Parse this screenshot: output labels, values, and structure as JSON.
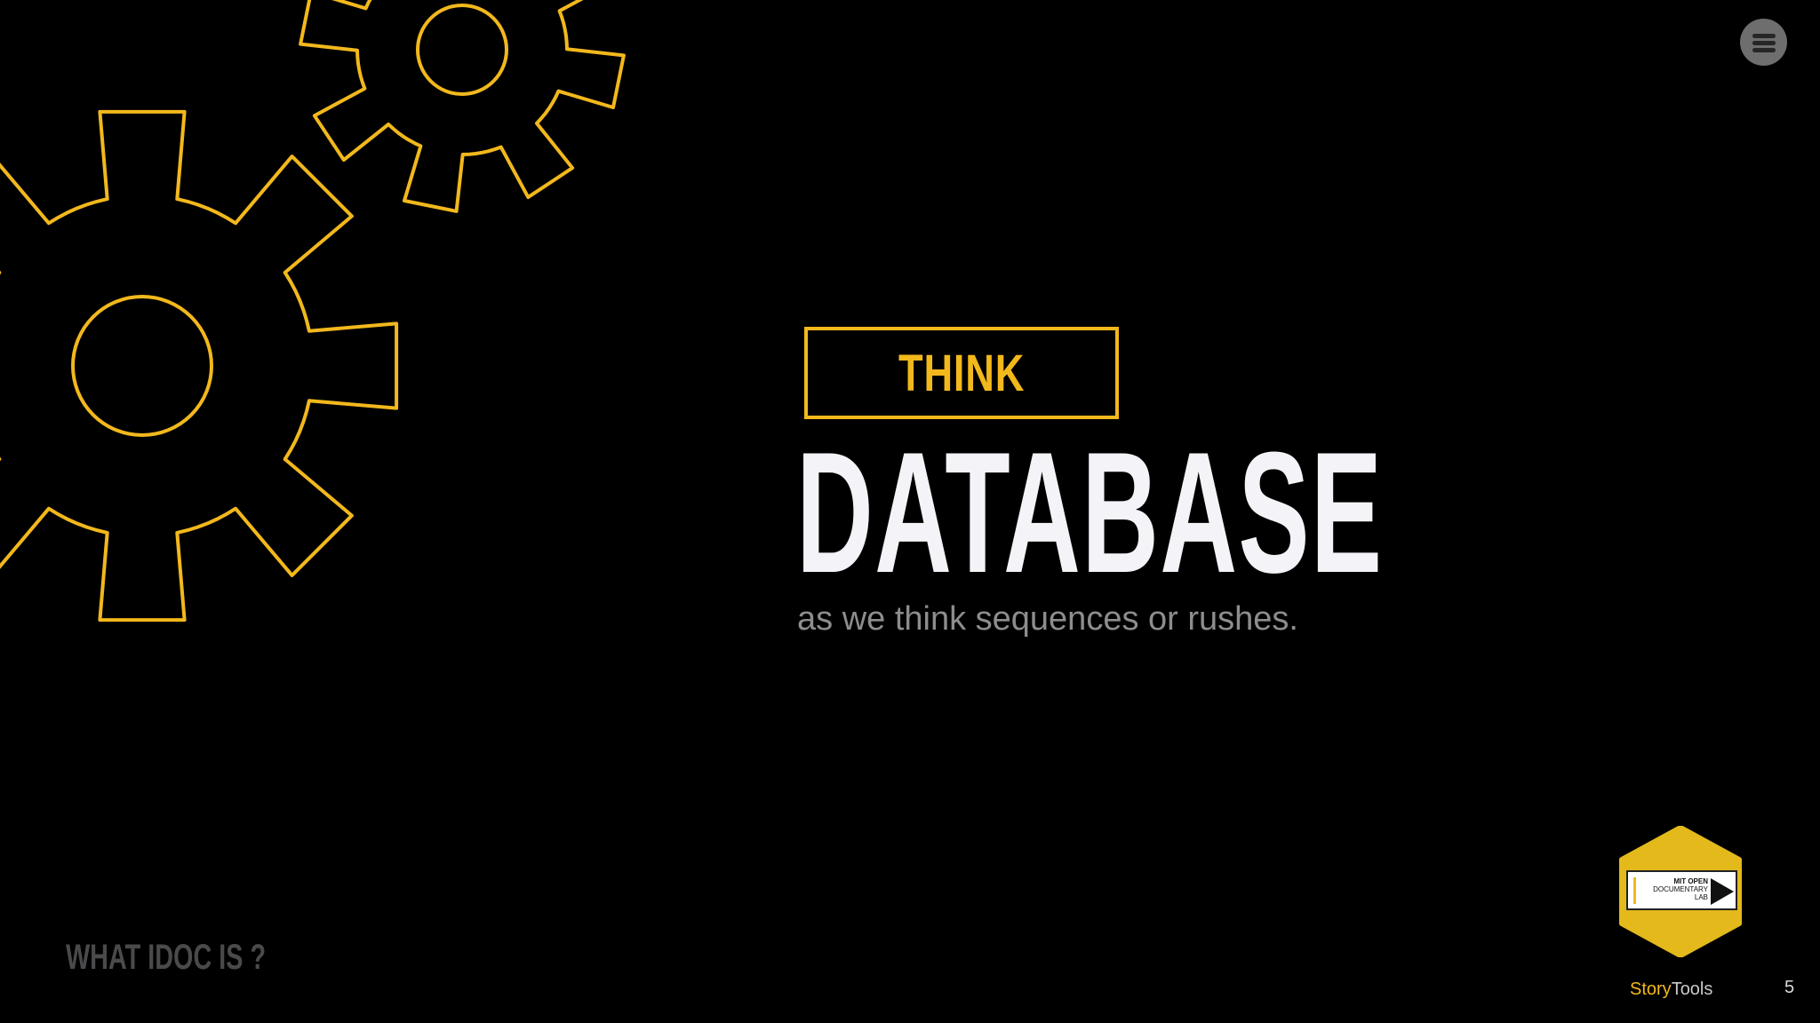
{
  "slide": {
    "think_label": "THINK",
    "headline": "DATABASE",
    "subtitle": "as we think sequences or rushes.",
    "section_label": "WHAT IDOC IS ?",
    "page_number": "5"
  },
  "menu": {
    "icon": "hamburger-menu-icon"
  },
  "logo": {
    "line1": "MIT OPEN",
    "line2": "DOCUMENTARY",
    "line3": "LAB",
    "icon": "play-icon"
  },
  "brand": {
    "part1": "Story",
    "part2": "Tools"
  },
  "decoration": {
    "icon": "gear-icon"
  },
  "colors": {
    "background": "#000000",
    "accent": "#f2b81c",
    "headline": "#f4f3f7",
    "subtitle": "#8d8d8d",
    "section_label": "#4a4a4c"
  }
}
